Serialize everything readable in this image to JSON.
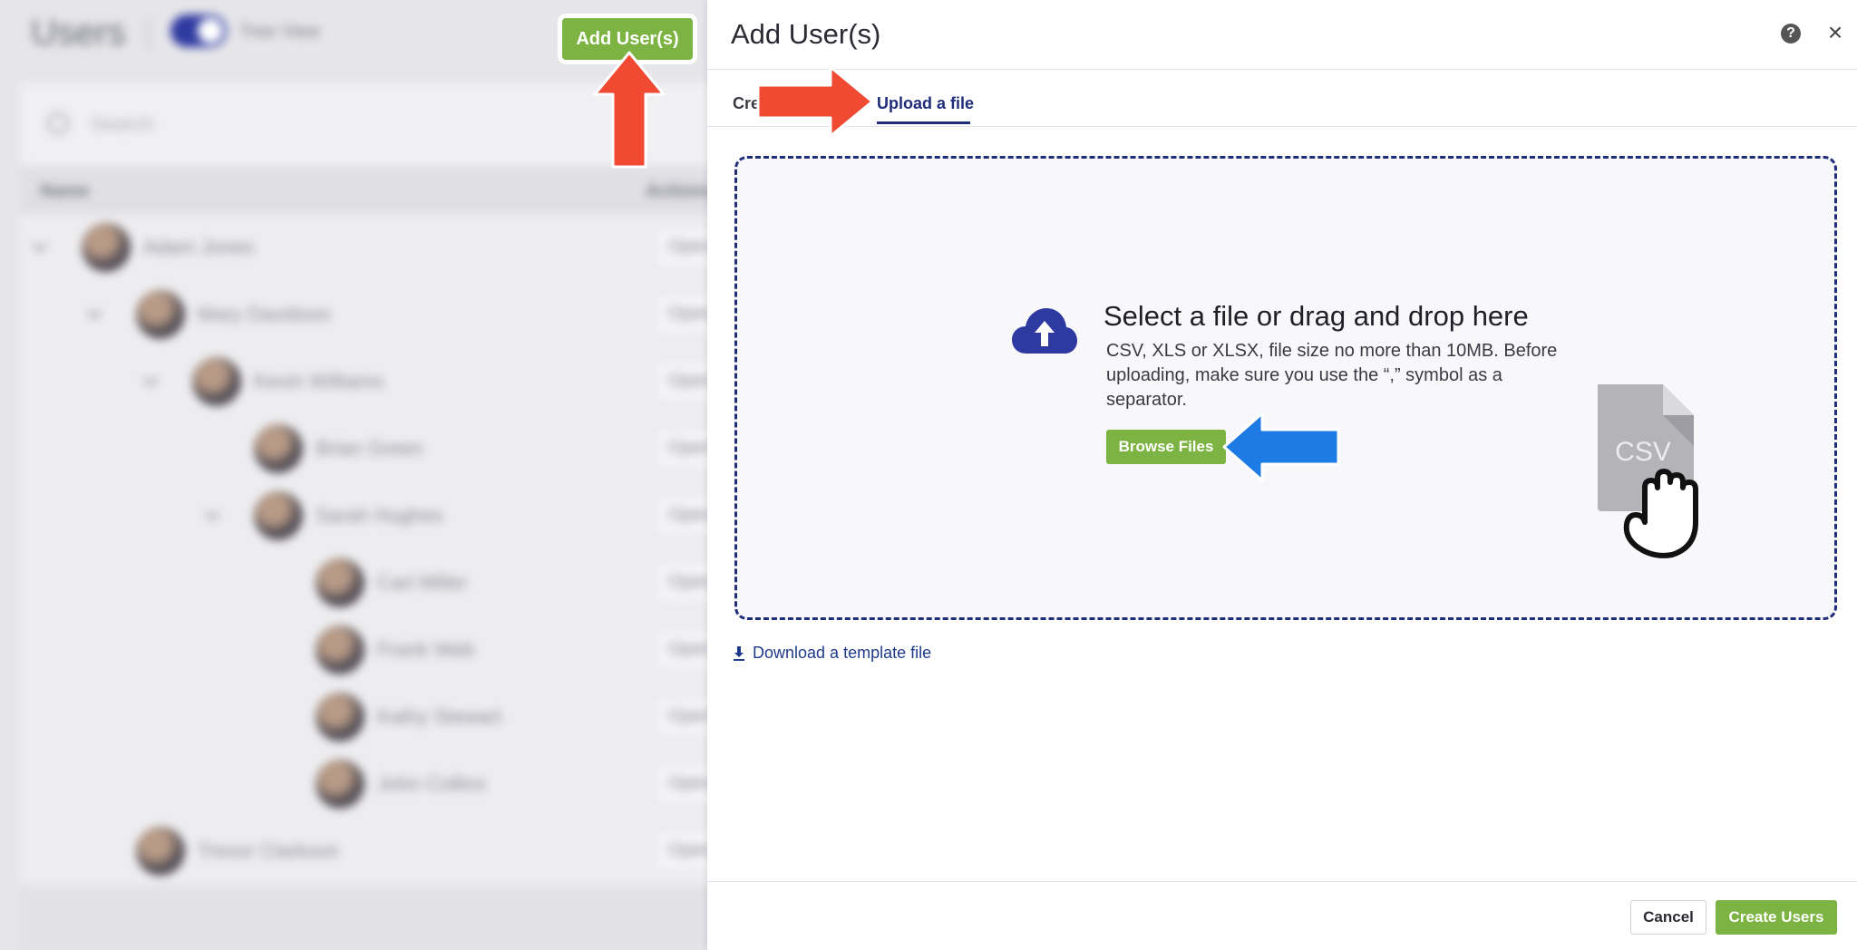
{
  "background": {
    "page_title": "Users",
    "tree_view_label": "Tree View",
    "search_placeholder": "Search",
    "columns": {
      "name": "Name",
      "actions": "Actions"
    },
    "rows": [
      {
        "name": "Adam Jones",
        "action": "Open"
      },
      {
        "name": "Mary Davidson",
        "action": "Open"
      },
      {
        "name": "Kevin Williams",
        "action": "Open"
      },
      {
        "name": "Brian Green",
        "action": "Open"
      },
      {
        "name": "Sarah Hughes",
        "action": "Open"
      },
      {
        "name": "Carl Miller",
        "action": "Open"
      },
      {
        "name": "Frank Web",
        "action": "Open"
      },
      {
        "name": "Kathy Stewart",
        "action": "Open"
      },
      {
        "name": "John Collins",
        "action": "Open"
      },
      {
        "name": "Trevor Clarkson",
        "action": "Open"
      }
    ],
    "add_users_label": "Add User(s)"
  },
  "panel": {
    "title": "Add User(s)",
    "help_icon": "question-circle-icon",
    "close_icon": "close-icon",
    "tabs": [
      {
        "label": "Create"
      },
      {
        "label": "Upload a file"
      }
    ],
    "dropzone": {
      "title": "Select a file or drag and drop here",
      "description": "CSV, XLS or XLSX, file size no more than 10MB. Before uploading, make sure you use the “,” symbol as a separator.",
      "browse_label": "Browse Files",
      "icon": "cloud-upload-icon",
      "illustration_label": "CSV"
    },
    "download_template_label": "Download a template file",
    "footer": {
      "cancel_label": "Cancel",
      "create_label": "Create Users"
    }
  },
  "colors": {
    "accent_green": "#7cb342",
    "navy": "#1f2d7a",
    "annotation_red": "#f04a32",
    "annotation_blue": "#1e7be6"
  }
}
